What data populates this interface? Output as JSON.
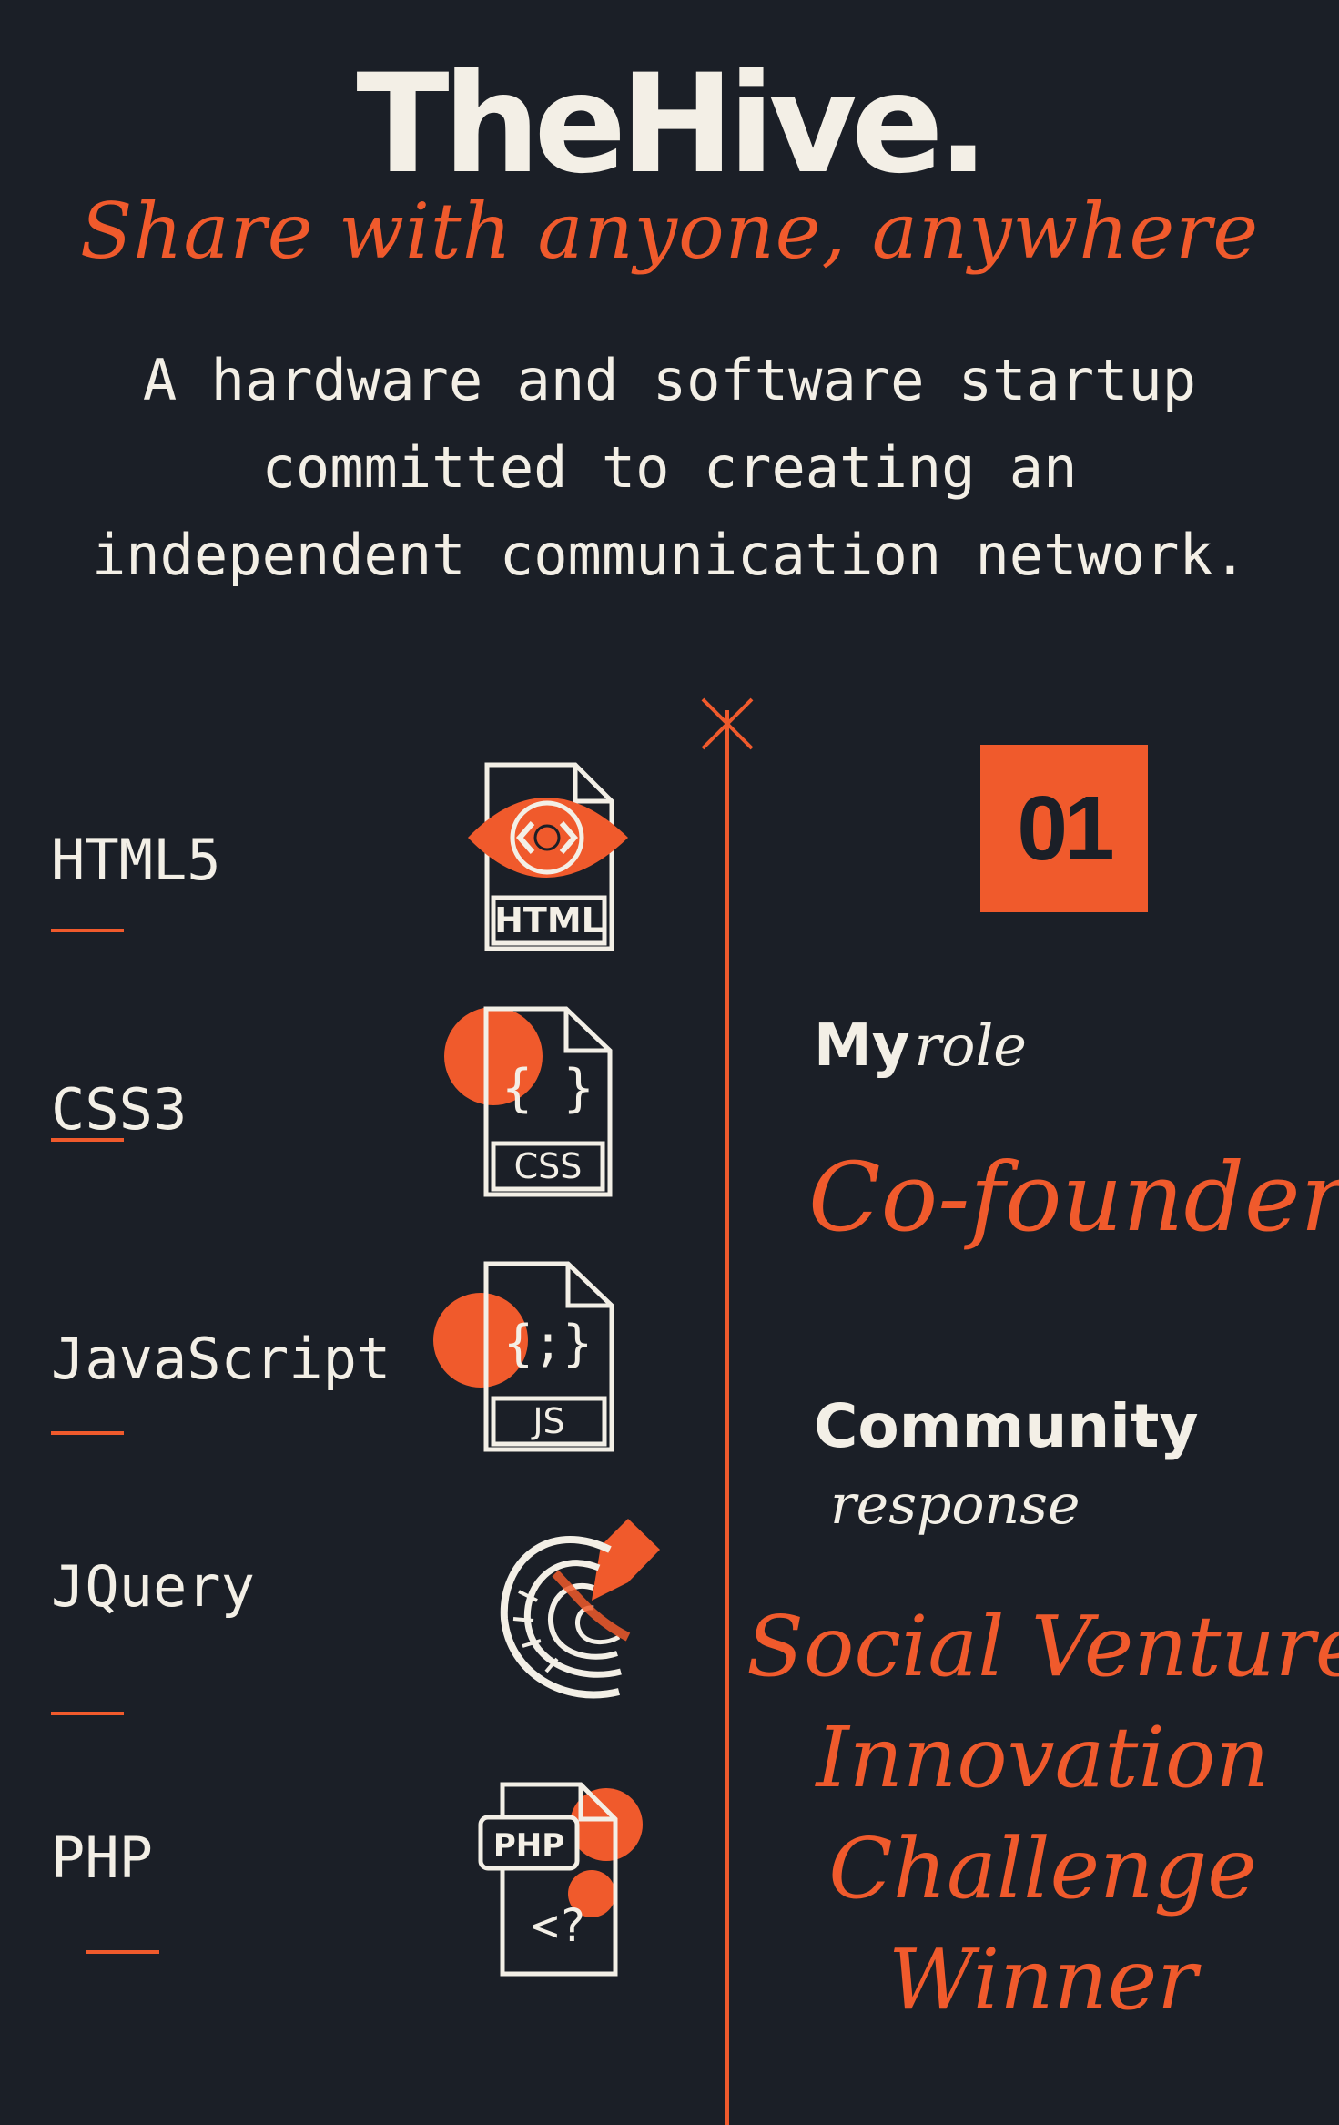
{
  "header": {
    "title": "TheHive.",
    "tagline": "Share with anyone, anywhere",
    "description": [
      "A hardware and software startup",
      "committed to creating an",
      "independent communication network."
    ]
  },
  "skills": [
    {
      "label": "HTML5",
      "icon": "html-file-icon",
      "icon_text": "HTML"
    },
    {
      "label": "CSS3",
      "icon": "css-file-icon",
      "icon_text": "CSS"
    },
    {
      "label": "JavaScript",
      "icon": "js-file-icon",
      "icon_text": "JS"
    },
    {
      "label": "JQuery",
      "icon": "jquery-icon"
    },
    {
      "label": "PHP",
      "icon": "php-file-icon",
      "icon_text": "PHP"
    }
  ],
  "project": {
    "number": "01",
    "role_heading_bold": "My",
    "role_heading_script": "role",
    "role_value": "Co-founder",
    "community_bold": "Community",
    "community_script": "response",
    "award_lines": [
      "Social Venture",
      "Innovation",
      "Challenge",
      "Winner"
    ]
  },
  "colors": {
    "background": "#1b1f27",
    "accent": "#f05a2c",
    "text": "#f3efe6"
  }
}
